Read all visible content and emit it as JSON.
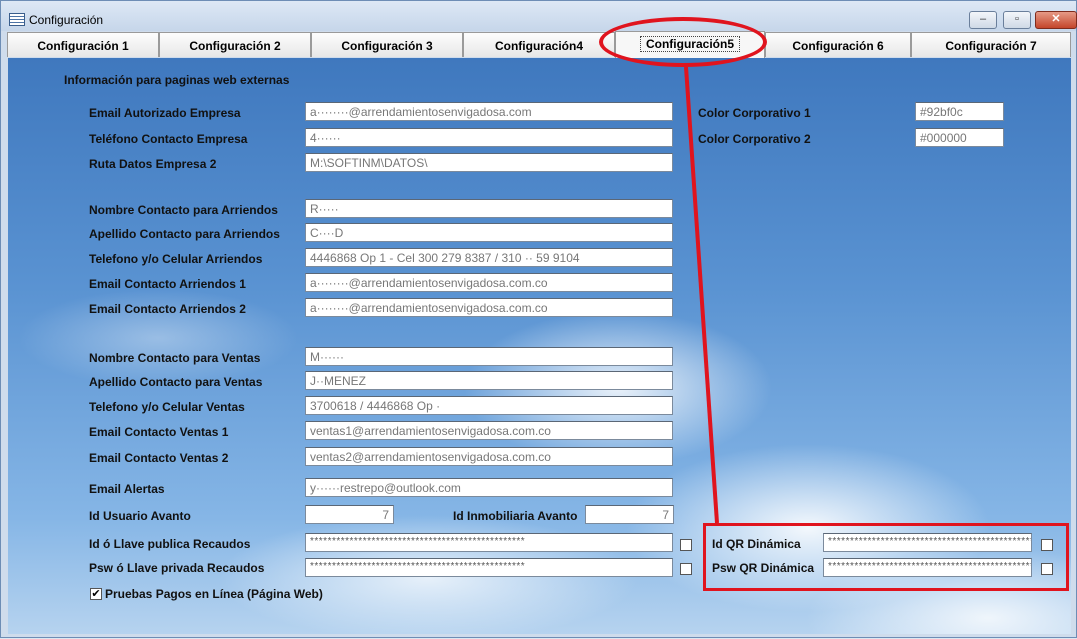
{
  "window": {
    "title": "Configuración",
    "minimize": "–",
    "maximize": "▫",
    "close": "✕"
  },
  "tabs": [
    {
      "label": "Configuración 1"
    },
    {
      "label": "Configuración 2"
    },
    {
      "label": "Configuración 3"
    },
    {
      "label": "Configuración4"
    },
    {
      "label": "Configuración5",
      "active": true
    },
    {
      "label": "Configuración 6"
    },
    {
      "label": "Configuración 7"
    }
  ],
  "section_title": "Información para paginas web externas",
  "company": {
    "email_label": "Email Autorizado Empresa",
    "email_value": "a········@arrendamientosenvigadosa.com",
    "phone_label": "Teléfono Contacto Empresa",
    "phone_value": "4······",
    "path_label": "Ruta Datos Empresa 2",
    "path_value": "M:\\SOFTINM\\DATOS\\"
  },
  "corporate": {
    "color1_label": "Color Corporativo 1",
    "color1_value": "#92bf0c",
    "color2_label": "Color Corporativo 2",
    "color2_value": "#000000"
  },
  "rentals": {
    "name_label": "Nombre Contacto para Arriendos",
    "name_value": "R·····",
    "lastname_label": "Apellido Contacto para Arriendos",
    "lastname_value": "C····D",
    "phone_label": "Telefono y/o Celular Arriendos",
    "phone_value": "4446868 Op 1 - Cel 300 279 8387 / 310 ·· 59 9104",
    "email1_label": "Email Contacto Arriendos 1",
    "email1_value": "a········@arrendamientosenvigadosa.com.co",
    "email2_label": "Email Contacto Arriendos 2",
    "email2_value": "a········@arrendamientosenvigadosa.com.co"
  },
  "sales": {
    "name_label": "Nombre Contacto para Ventas",
    "name_value": "M······",
    "lastname_label": "Apellido Contacto para Ventas",
    "lastname_value": "J··MENEZ",
    "phone_label": "Telefono y/o Celular Ventas",
    "phone_value": "3700618 / 4446868 Op ·",
    "email1_label": "Email Contacto Ventas 1",
    "email1_value": "ventas1@arrendamientosenvigadosa.com.co",
    "email2_label": "Email Contacto Ventas 2",
    "email2_value": "ventas2@arrendamientosenvigadosa.com.co"
  },
  "alerts": {
    "label": "Email Alertas",
    "value": "y······restrepo@outlook.com"
  },
  "avanto": {
    "user_label": "Id Usuario Avanto",
    "user_value": "7",
    "inmob_label": "Id Inmobiliaria Avanto",
    "inmob_value": "7"
  },
  "recaudos": {
    "public_label": "Id ó Llave publica Recaudos",
    "public_value": "*************************************************",
    "private_label": "Psw ó Llave privada  Recaudos",
    "private_value": "*************************************************"
  },
  "qr": {
    "id_label": "Id QR Dinámica",
    "id_value": "***********************************************",
    "psw_label": "Psw QR Dinámica",
    "psw_value": "***********************************************"
  },
  "test_payments": {
    "label": "Pruebas Pagos en Línea (Página Web)",
    "checked": true,
    "check_glyph": "✔"
  },
  "annotation_color": "#e0141e"
}
